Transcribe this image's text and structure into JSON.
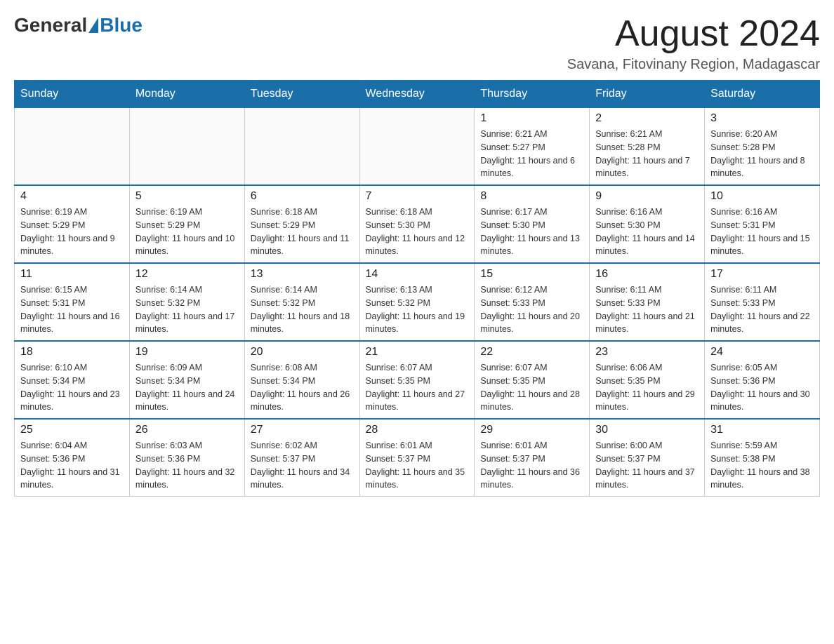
{
  "header": {
    "logo_general": "General",
    "logo_blue": "Blue",
    "month_title": "August 2024",
    "location": "Savana, Fitovinany Region, Madagascar"
  },
  "days_of_week": [
    "Sunday",
    "Monday",
    "Tuesday",
    "Wednesday",
    "Thursday",
    "Friday",
    "Saturday"
  ],
  "weeks": [
    [
      {
        "day": "",
        "sunrise": "",
        "sunset": "",
        "daylight": ""
      },
      {
        "day": "",
        "sunrise": "",
        "sunset": "",
        "daylight": ""
      },
      {
        "day": "",
        "sunrise": "",
        "sunset": "",
        "daylight": ""
      },
      {
        "day": "",
        "sunrise": "",
        "sunset": "",
        "daylight": ""
      },
      {
        "day": "1",
        "sunrise": "Sunrise: 6:21 AM",
        "sunset": "Sunset: 5:27 PM",
        "daylight": "Daylight: 11 hours and 6 minutes."
      },
      {
        "day": "2",
        "sunrise": "Sunrise: 6:21 AM",
        "sunset": "Sunset: 5:28 PM",
        "daylight": "Daylight: 11 hours and 7 minutes."
      },
      {
        "day": "3",
        "sunrise": "Sunrise: 6:20 AM",
        "sunset": "Sunset: 5:28 PM",
        "daylight": "Daylight: 11 hours and 8 minutes."
      }
    ],
    [
      {
        "day": "4",
        "sunrise": "Sunrise: 6:19 AM",
        "sunset": "Sunset: 5:29 PM",
        "daylight": "Daylight: 11 hours and 9 minutes."
      },
      {
        "day": "5",
        "sunrise": "Sunrise: 6:19 AM",
        "sunset": "Sunset: 5:29 PM",
        "daylight": "Daylight: 11 hours and 10 minutes."
      },
      {
        "day": "6",
        "sunrise": "Sunrise: 6:18 AM",
        "sunset": "Sunset: 5:29 PM",
        "daylight": "Daylight: 11 hours and 11 minutes."
      },
      {
        "day": "7",
        "sunrise": "Sunrise: 6:18 AM",
        "sunset": "Sunset: 5:30 PM",
        "daylight": "Daylight: 11 hours and 12 minutes."
      },
      {
        "day": "8",
        "sunrise": "Sunrise: 6:17 AM",
        "sunset": "Sunset: 5:30 PM",
        "daylight": "Daylight: 11 hours and 13 minutes."
      },
      {
        "day": "9",
        "sunrise": "Sunrise: 6:16 AM",
        "sunset": "Sunset: 5:30 PM",
        "daylight": "Daylight: 11 hours and 14 minutes."
      },
      {
        "day": "10",
        "sunrise": "Sunrise: 6:16 AM",
        "sunset": "Sunset: 5:31 PM",
        "daylight": "Daylight: 11 hours and 15 minutes."
      }
    ],
    [
      {
        "day": "11",
        "sunrise": "Sunrise: 6:15 AM",
        "sunset": "Sunset: 5:31 PM",
        "daylight": "Daylight: 11 hours and 16 minutes."
      },
      {
        "day": "12",
        "sunrise": "Sunrise: 6:14 AM",
        "sunset": "Sunset: 5:32 PM",
        "daylight": "Daylight: 11 hours and 17 minutes."
      },
      {
        "day": "13",
        "sunrise": "Sunrise: 6:14 AM",
        "sunset": "Sunset: 5:32 PM",
        "daylight": "Daylight: 11 hours and 18 minutes."
      },
      {
        "day": "14",
        "sunrise": "Sunrise: 6:13 AM",
        "sunset": "Sunset: 5:32 PM",
        "daylight": "Daylight: 11 hours and 19 minutes."
      },
      {
        "day": "15",
        "sunrise": "Sunrise: 6:12 AM",
        "sunset": "Sunset: 5:33 PM",
        "daylight": "Daylight: 11 hours and 20 minutes."
      },
      {
        "day": "16",
        "sunrise": "Sunrise: 6:11 AM",
        "sunset": "Sunset: 5:33 PM",
        "daylight": "Daylight: 11 hours and 21 minutes."
      },
      {
        "day": "17",
        "sunrise": "Sunrise: 6:11 AM",
        "sunset": "Sunset: 5:33 PM",
        "daylight": "Daylight: 11 hours and 22 minutes."
      }
    ],
    [
      {
        "day": "18",
        "sunrise": "Sunrise: 6:10 AM",
        "sunset": "Sunset: 5:34 PM",
        "daylight": "Daylight: 11 hours and 23 minutes."
      },
      {
        "day": "19",
        "sunrise": "Sunrise: 6:09 AM",
        "sunset": "Sunset: 5:34 PM",
        "daylight": "Daylight: 11 hours and 24 minutes."
      },
      {
        "day": "20",
        "sunrise": "Sunrise: 6:08 AM",
        "sunset": "Sunset: 5:34 PM",
        "daylight": "Daylight: 11 hours and 26 minutes."
      },
      {
        "day": "21",
        "sunrise": "Sunrise: 6:07 AM",
        "sunset": "Sunset: 5:35 PM",
        "daylight": "Daylight: 11 hours and 27 minutes."
      },
      {
        "day": "22",
        "sunrise": "Sunrise: 6:07 AM",
        "sunset": "Sunset: 5:35 PM",
        "daylight": "Daylight: 11 hours and 28 minutes."
      },
      {
        "day": "23",
        "sunrise": "Sunrise: 6:06 AM",
        "sunset": "Sunset: 5:35 PM",
        "daylight": "Daylight: 11 hours and 29 minutes."
      },
      {
        "day": "24",
        "sunrise": "Sunrise: 6:05 AM",
        "sunset": "Sunset: 5:36 PM",
        "daylight": "Daylight: 11 hours and 30 minutes."
      }
    ],
    [
      {
        "day": "25",
        "sunrise": "Sunrise: 6:04 AM",
        "sunset": "Sunset: 5:36 PM",
        "daylight": "Daylight: 11 hours and 31 minutes."
      },
      {
        "day": "26",
        "sunrise": "Sunrise: 6:03 AM",
        "sunset": "Sunset: 5:36 PM",
        "daylight": "Daylight: 11 hours and 32 minutes."
      },
      {
        "day": "27",
        "sunrise": "Sunrise: 6:02 AM",
        "sunset": "Sunset: 5:37 PM",
        "daylight": "Daylight: 11 hours and 34 minutes."
      },
      {
        "day": "28",
        "sunrise": "Sunrise: 6:01 AM",
        "sunset": "Sunset: 5:37 PM",
        "daylight": "Daylight: 11 hours and 35 minutes."
      },
      {
        "day": "29",
        "sunrise": "Sunrise: 6:01 AM",
        "sunset": "Sunset: 5:37 PM",
        "daylight": "Daylight: 11 hours and 36 minutes."
      },
      {
        "day": "30",
        "sunrise": "Sunrise: 6:00 AM",
        "sunset": "Sunset: 5:37 PM",
        "daylight": "Daylight: 11 hours and 37 minutes."
      },
      {
        "day": "31",
        "sunrise": "Sunrise: 5:59 AM",
        "sunset": "Sunset: 5:38 PM",
        "daylight": "Daylight: 11 hours and 38 minutes."
      }
    ]
  ]
}
